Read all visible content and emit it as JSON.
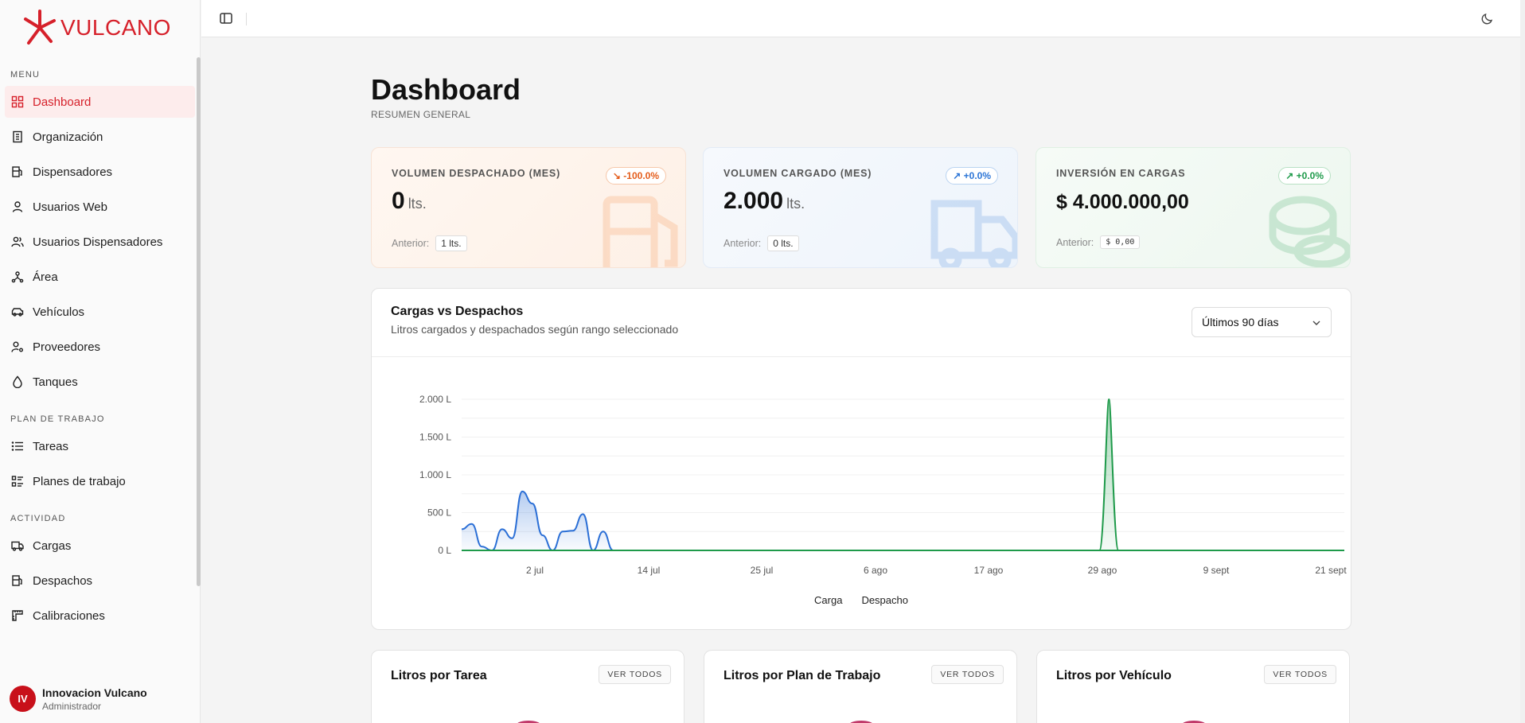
{
  "brand": {
    "name": "VULCANO"
  },
  "sidebar": {
    "sections": [
      {
        "label": "MENU"
      },
      {
        "label": "PLAN DE TRABAJO"
      },
      {
        "label": "ACTIVIDAD"
      }
    ],
    "items": [
      {
        "label": "Dashboard",
        "icon": "dashboard-icon"
      },
      {
        "label": "Organización",
        "icon": "building-icon"
      },
      {
        "label": "Dispensadores",
        "icon": "fuel-pump-icon"
      },
      {
        "label": "Usuarios Web",
        "icon": "user-icon"
      },
      {
        "label": "Usuarios Dispensadores",
        "icon": "users-icon"
      },
      {
        "label": "Área",
        "icon": "network-icon"
      },
      {
        "label": "Vehículos",
        "icon": "car-icon"
      },
      {
        "label": "Proveedores",
        "icon": "user-cog-icon"
      },
      {
        "label": "Tanques",
        "icon": "droplet-icon"
      },
      {
        "label": "Tareas",
        "icon": "list-icon"
      },
      {
        "label": "Planes de trabajo",
        "icon": "checklist-icon"
      },
      {
        "label": "Cargas",
        "icon": "truck-icon"
      },
      {
        "label": "Despachos",
        "icon": "fuel-pump-icon"
      },
      {
        "label": "Calibraciones",
        "icon": "ruler-icon"
      }
    ],
    "user": {
      "initials": "IV",
      "name": "Innovacion Vulcano",
      "role": "Administrador"
    }
  },
  "header": {
    "title": "Dashboard",
    "subtitle": "RESUMEN GENERAL"
  },
  "kpis": [
    {
      "label": "VOLUMEN DESPACHADO (MES)",
      "badge": "↘ -100.0%",
      "value": "0",
      "unit": "lts.",
      "prev_label": "Anterior:",
      "prev_value": "1 lts.",
      "accent": "#e45c1a"
    },
    {
      "label": "VOLUMEN CARGADO (MES)",
      "badge": "↗ +0.0%",
      "value": "2.000",
      "unit": "lts.",
      "prev_label": "Anterior:",
      "prev_value": "0 lts.",
      "accent": "#2a74d6"
    },
    {
      "label": "INVERSIÓN EN CARGAS",
      "badge": "↗ +0.0%",
      "value": "$ 4.000.000,00",
      "unit": "",
      "prev_label": "Anterior:",
      "prev_value": "$ 0,00",
      "accent": "#1e9a4a"
    }
  ],
  "chart": {
    "title": "Cargas vs Despachos",
    "subtitle": "Litros cargados y despachados según rango seleccionado",
    "range_selected": "Últimos 90 días",
    "legend": [
      "Carga",
      "Despacho"
    ]
  },
  "chart_data": {
    "type": "area",
    "yticks": [
      "2.000 L",
      "1.500 L",
      "1.000 L",
      "500 L",
      "0 L"
    ],
    "xticks": [
      "2 jul",
      "14 jul",
      "25 jul",
      "6 ago",
      "17 ago",
      "29 ago",
      "9 sept",
      "21 sept"
    ],
    "ylim": [
      0,
      2000
    ],
    "series": [
      {
        "name": "Carga",
        "color": "#2b6fd6",
        "points": [
          [
            0,
            280
          ],
          [
            1,
            350
          ],
          [
            2,
            50
          ],
          [
            3,
            0
          ],
          [
            4,
            280
          ],
          [
            5,
            160
          ],
          [
            6,
            780
          ],
          [
            7,
            620
          ],
          [
            8,
            200
          ],
          [
            9,
            0
          ],
          [
            10,
            250
          ],
          [
            11,
            260
          ],
          [
            12,
            480
          ],
          [
            13,
            0
          ],
          [
            14,
            250
          ],
          [
            15,
            0
          ]
        ]
      },
      {
        "name": "Despacho",
        "color": "#1e9a4a",
        "points": [
          [
            0,
            0
          ],
          [
            65,
            0
          ],
          [
            66,
            2000
          ],
          [
            67,
            0
          ],
          [
            90,
            0
          ]
        ]
      }
    ]
  },
  "bottom_cards": [
    {
      "title": "Litros por Tarea",
      "button": "VER TODOS"
    },
    {
      "title": "Litros por Plan de Trabajo",
      "button": "VER TODOS"
    },
    {
      "title": "Litros por Vehículo",
      "button": "VER TODOS"
    }
  ]
}
